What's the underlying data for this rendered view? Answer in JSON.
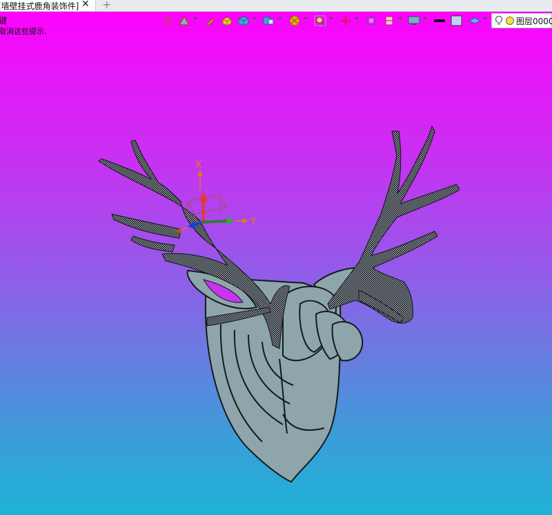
{
  "tab": {
    "title": "[墙壁挂式鹿角装饰件]",
    "close_glyph": "✕",
    "new_glyph": "+"
  },
  "hints": {
    "line1": "键",
    "line2": "取消这些提示."
  },
  "layer": {
    "label": "图层0000"
  },
  "triad": {
    "x_label": "X",
    "y_label": "Y"
  },
  "colors": {
    "background_top": "#fd03fe",
    "background_bottom": "#1fb2d6",
    "model_fill": "#8ea5ac",
    "antler_fill": "#1d2429"
  },
  "toolbar_icons": [
    "exit-icon",
    "measure-icon",
    "pencil-icon",
    "solid-box-icon",
    "cube-view-icon",
    "view-orient-icon",
    "render-ball-icon",
    "zoom-icon",
    "pan-cross-icon",
    "fit-icon",
    "section-icon",
    "display-icon",
    "line-color-icon",
    "fill-color-icon",
    "layer-toggle-icon",
    "lightbulb-icon",
    "layer-status-icon"
  ]
}
